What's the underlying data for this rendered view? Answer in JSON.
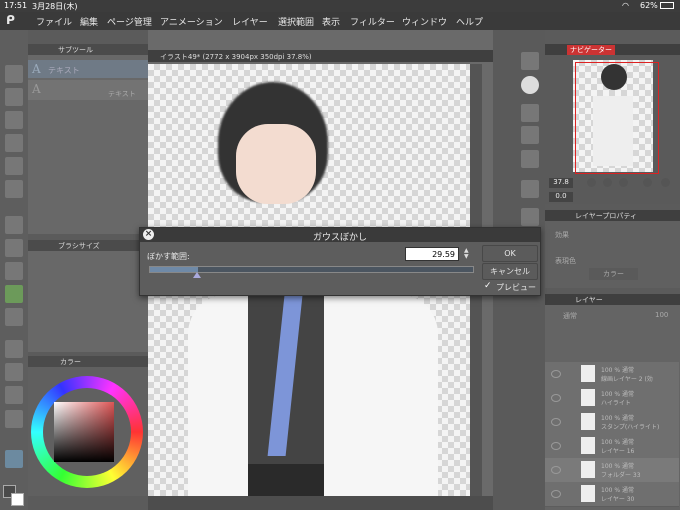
{
  "status": {
    "time": "17:51",
    "date": "3月28日(木)",
    "battery": "62%"
  },
  "menu": [
    "ファイル",
    "編集",
    "ページ管理",
    "アニメーション",
    "レイヤー",
    "選択範囲",
    "表示",
    "フィルター",
    "ウィンドウ",
    "ヘルプ"
  ],
  "subtool": {
    "title": "サブツール",
    "items": [
      "テキスト",
      "テキスト"
    ]
  },
  "brush": {
    "title": "ブラシサイズ"
  },
  "color": {
    "title": "カラー"
  },
  "canvas": {
    "tab_title": "イラスト49* (2772 x 3904px 350dpi 37.8%)"
  },
  "dialog": {
    "title": "ガウスぼかし",
    "range_label": "ぼかす範囲:",
    "range_value": "29.59",
    "slider_fraction": 0.15,
    "ok": "OK",
    "cancel": "キャンセル",
    "preview": "プレビュー",
    "preview_checked": true
  },
  "navigator": {
    "title": "ナビゲーター",
    "zoom": "37.8",
    "rotate": "0.0"
  },
  "layer_props": {
    "title": "レイヤープロパティ",
    "effect": "効果",
    "display_color": "表現色",
    "color_mode": "カラー"
  },
  "layers": {
    "title": "レイヤー",
    "blend": "通常",
    "opacity": "100",
    "rows": [
      {
        "l1": "100 % 通常",
        "l2": "線画レイヤー 2 (効"
      },
      {
        "l1": "100 % 通常",
        "l2": "ハイライト"
      },
      {
        "l1": "100 % 通常",
        "l2": "スタンプ(ハイライト)"
      },
      {
        "l1": "100 % 通常",
        "l2": "レイヤー 16"
      },
      {
        "l1": "100 % 通常",
        "l2": "フォルダー 33"
      },
      {
        "l1": "100 % 通常",
        "l2": "レイヤー 30"
      }
    ]
  }
}
